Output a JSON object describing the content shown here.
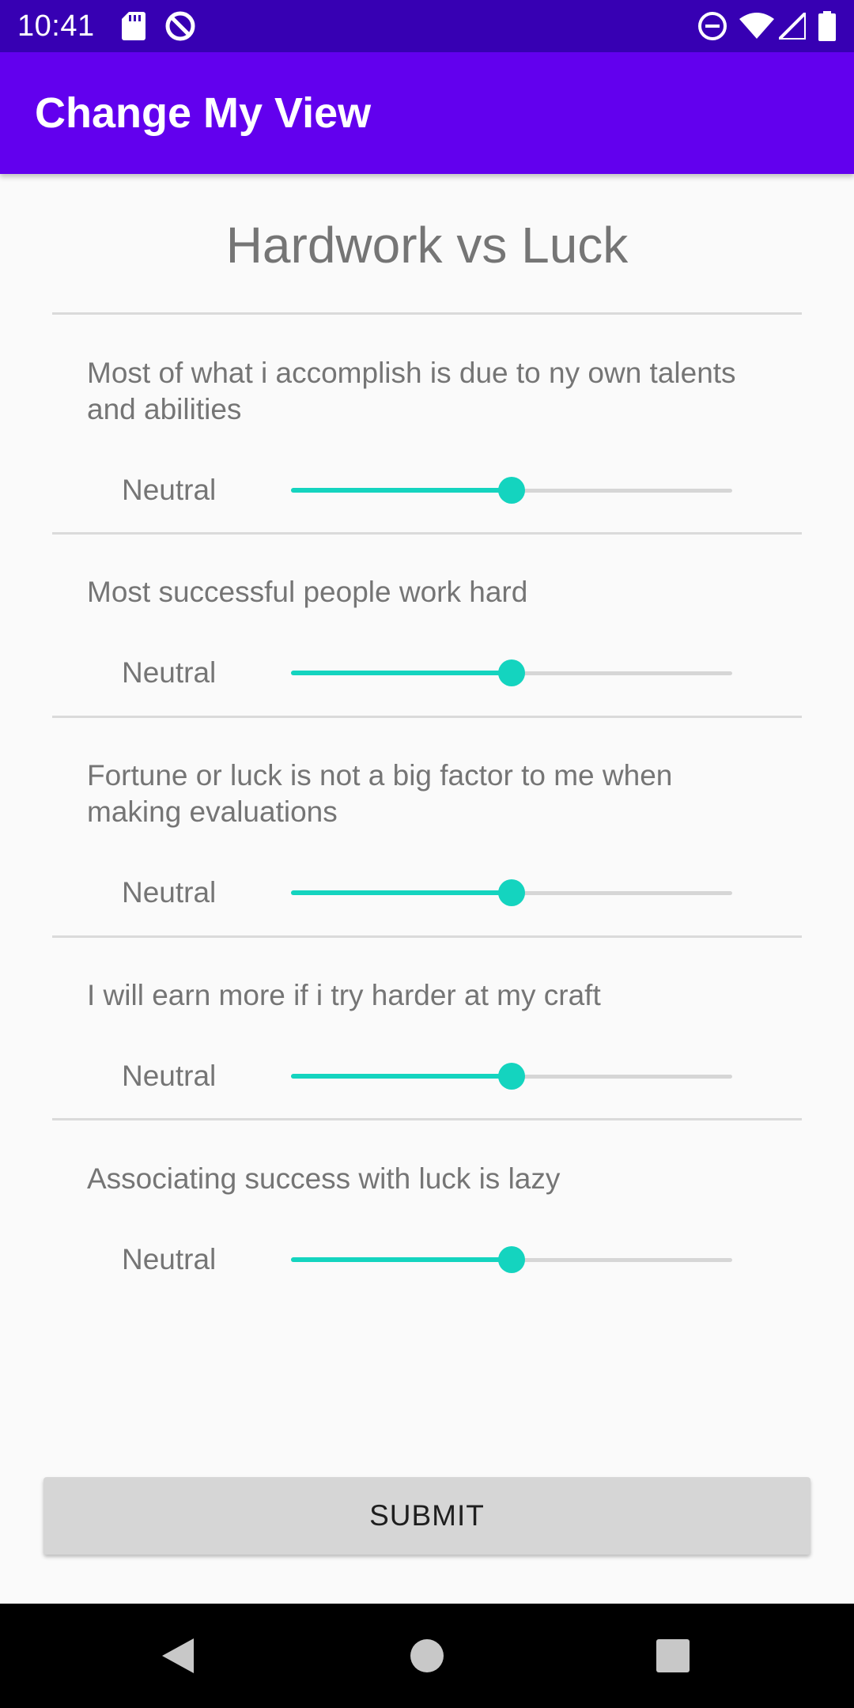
{
  "status_bar": {
    "time": "10:41",
    "left_icons": [
      "sd-card-icon",
      "sync-off-icon"
    ],
    "right_icons": [
      "do-not-disturb-icon",
      "wifi-icon",
      "signal-icon",
      "battery-icon"
    ]
  },
  "app_bar": {
    "title": "Change My View",
    "color": "#6200ee"
  },
  "page": {
    "title": "Hardwork vs Luck"
  },
  "questions": [
    {
      "text": "Most of what i accomplish is due to ny own talents and abilities",
      "value_label": "Neutral",
      "value": 0.5
    },
    {
      "text": "Most successful people work hard",
      "value_label": "Neutral",
      "value": 0.5
    },
    {
      "text": "Fortune or luck is not a big factor to me when making evaluations",
      "value_label": "Neutral",
      "value": 0.5
    },
    {
      "text": "I will earn more if i try harder at my craft",
      "value_label": "Neutral",
      "value": 0.5
    },
    {
      "text": "Associating success with luck is lazy",
      "value_label": "Neutral",
      "value": 0.5
    }
  ],
  "slider_color": "#14d4bf",
  "submit": {
    "label": "SUBMIT"
  },
  "nav_bar": {
    "buttons": [
      "back-icon",
      "home-icon",
      "recents-icon"
    ]
  }
}
